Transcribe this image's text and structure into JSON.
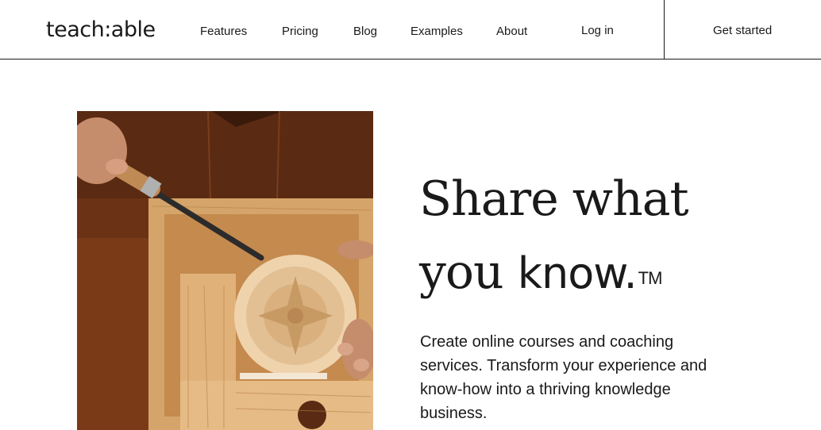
{
  "header": {
    "logo": "teach:able",
    "nav": [
      "Features",
      "Pricing",
      "Blog",
      "Examples",
      "About"
    ],
    "login_label": "Log in",
    "cta_label": "Get started"
  },
  "hero": {
    "headline_line1": "Share what",
    "headline_line2_light": "you",
    "headline_line2_strong": "know.",
    "trademark": "TM",
    "subtext": "Create online courses and coaching services. Transform your experience and know-how into a thriving knowledge business.",
    "image_icon": "wood-carving-photo"
  },
  "colors": {
    "text": "#1a1a1a",
    "background": "#ffffff",
    "leather": "#6b3216",
    "wood": "#d9aa72"
  }
}
